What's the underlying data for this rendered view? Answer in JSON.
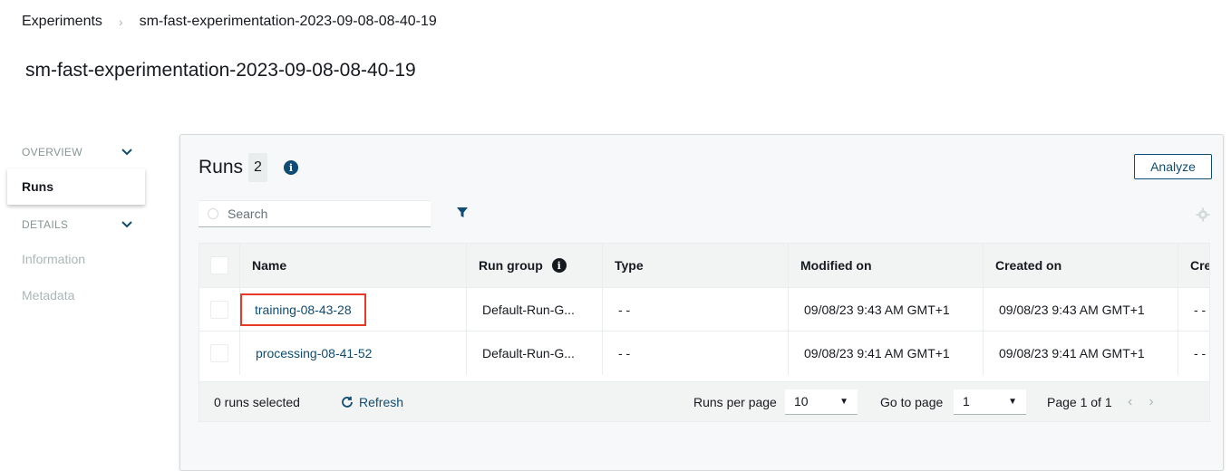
{
  "breadcrumb": {
    "root": "Experiments",
    "current": "sm-fast-experimentation-2023-09-08-08-40-19"
  },
  "page_title": "sm-fast-experimentation-2023-09-08-08-40-19",
  "sidebar": {
    "overview_label": "OVERVIEW",
    "runs_label": "Runs",
    "details_label": "DETAILS",
    "information_label": "Information",
    "metadata_label": "Metadata"
  },
  "runs": {
    "title": "Runs",
    "count": "2",
    "analyze_label": "Analyze",
    "search_placeholder": "Search",
    "columns": {
      "name": "Name",
      "run_group": "Run group",
      "type": "Type",
      "modified_on": "Modified on",
      "created_on": "Created on",
      "created_by": "Cre"
    },
    "rows": [
      {
        "name": "training-08-43-28",
        "run_group": "Default-Run-G...",
        "type": "- -",
        "modified_on": "09/08/23 9:43 AM GMT+1",
        "created_on": "09/08/23 9:43 AM GMT+1",
        "created_by": "- -"
      },
      {
        "name": "processing-08-41-52",
        "run_group": "Default-Run-G...",
        "type": "- -",
        "modified_on": "09/08/23 9:41 AM GMT+1",
        "created_on": "09/08/23 9:41 AM GMT+1",
        "created_by": "- -"
      }
    ],
    "footer": {
      "selected": "0 runs selected",
      "refresh_label": "Refresh",
      "runs_per_page_label": "Runs per page",
      "runs_per_page_value": "10",
      "go_to_page_label": "Go to page",
      "go_to_page_value": "1",
      "page_info": "Page 1 of 1"
    }
  },
  "colors": {
    "link": "#0f4c75",
    "highlight_border": "#e63a26"
  }
}
